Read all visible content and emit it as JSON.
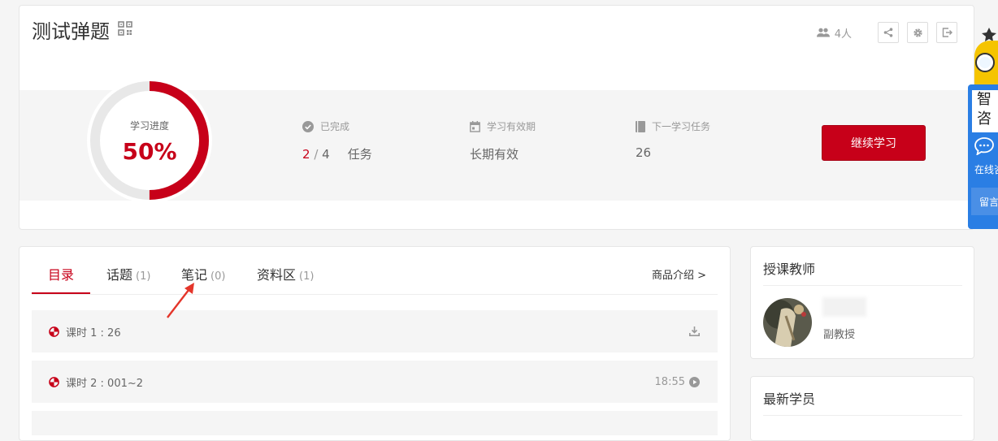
{
  "course": {
    "title": "测试弹题",
    "members": "4人"
  },
  "progress": {
    "label": "学习进度",
    "percent_text": "50%",
    "percent": 0.5,
    "completed_label": "已完成",
    "completed_done": "2",
    "completed_sep": " / ",
    "completed_total": "4",
    "completed_unit": "任务",
    "validity_label": "学习有效期",
    "validity_value": "长期有效",
    "next_label": "下一学习任务",
    "next_value": "26",
    "continue_button": "继续学习"
  },
  "tabs": [
    {
      "label": "目录",
      "count": ""
    },
    {
      "label": "话题",
      "count": "(1)"
    },
    {
      "label": "笔记",
      "count": "(0)"
    },
    {
      "label": "资料区",
      "count": "(1)"
    }
  ],
  "product_intro": "商品介绍 >",
  "lessons": [
    {
      "title": "课时 1 : 26",
      "right": ""
    },
    {
      "title": "课时 2 : 001~2",
      "right": "18:55"
    }
  ],
  "teacher": {
    "section_title": "授课教师",
    "role": "副教授"
  },
  "students": {
    "section_title": "最新学员"
  },
  "float_widget": {
    "zhi": "智",
    "zi": "咨",
    "online": "在线咨",
    "message": "留言"
  },
  "colors": {
    "accent": "#c70019",
    "widget_blue": "#2a7ee4"
  }
}
